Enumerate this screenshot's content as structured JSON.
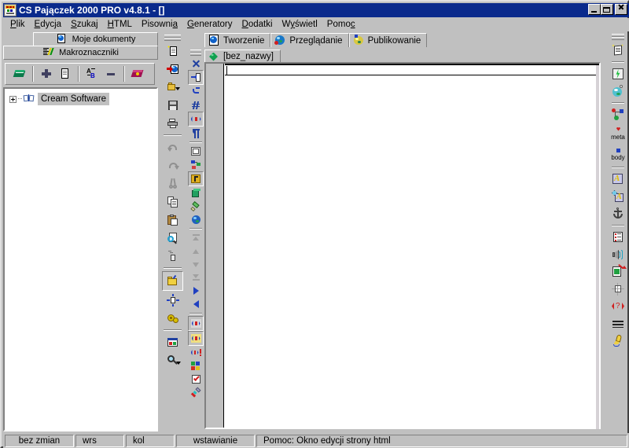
{
  "window": {
    "title": "CS Pajączek 2000 PRO v4.8.1 - []",
    "icon": "app-icon",
    "buttons": {
      "minimize": "_",
      "maximize": "□",
      "close": "✕"
    }
  },
  "menubar": {
    "items": [
      {
        "label": "Plik",
        "accel": "P"
      },
      {
        "label": "Edycja",
        "accel": "E"
      },
      {
        "label": "Szukaj",
        "accel": "S"
      },
      {
        "label": "HTML",
        "accel": "H"
      },
      {
        "label": "Pisownia",
        "accel": "a"
      },
      {
        "label": "Generatory",
        "accel": "G"
      },
      {
        "label": "Dodatki",
        "accel": "D"
      },
      {
        "label": "Wyświetl",
        "accel": "y"
      },
      {
        "label": "Pomoc",
        "accel": "c"
      }
    ]
  },
  "left_panel": {
    "tabs": [
      {
        "label": "Moje dokumenty",
        "icon": "globe-page-icon",
        "selected": true
      },
      {
        "label": "Makroznaczniki",
        "icon": "macro-lines-icon",
        "selected": false
      }
    ],
    "toolbar": [
      {
        "name": "open-book-button",
        "icon": "green-book-icon"
      },
      {
        "name": "add-button",
        "icon": "plus-icon"
      },
      {
        "name": "new-document-button",
        "icon": "document-icon"
      },
      {
        "name": "rename-button",
        "icon": "rename-ab-icon"
      },
      {
        "name": "remove-button",
        "icon": "minus-icon"
      },
      {
        "name": "close-book-button",
        "icon": "red-book-icon"
      }
    ],
    "tree": [
      {
        "label": "Cream Software",
        "icon": "open-book-icon",
        "expanded": false,
        "selected": true
      }
    ]
  },
  "main": {
    "tabs": [
      {
        "label": "Tworzenie",
        "icon": "globe-page-icon",
        "active": true
      },
      {
        "label": "Przeglądanie",
        "icon": "globe-blue-icon",
        "active": false
      },
      {
        "label": "Publikowanie",
        "icon": "globe-upload-icon",
        "active": false
      }
    ],
    "document_tabs": [
      {
        "label": "[bez_nazwy]",
        "icon": "green-diamond-icon",
        "active": true
      }
    ],
    "editor": {
      "content": "",
      "gutter_visible": true
    }
  },
  "toolbar_main": {
    "items": [
      {
        "name": "new-document",
        "icon": "new-doc-icon"
      },
      {
        "name": "new-web-document",
        "icon": "new-web-doc-icon"
      },
      {
        "name": "open-file",
        "icon": "open-folder-icon"
      },
      {
        "name": "save-file",
        "icon": "save-disk-icon"
      },
      {
        "name": "print",
        "icon": "printer-icon"
      },
      {
        "name": "undo",
        "icon": "undo-arrow-icon"
      },
      {
        "name": "redo",
        "icon": "redo-arrow-icon"
      },
      {
        "name": "cut",
        "icon": "scissors-icon"
      },
      {
        "name": "copy",
        "icon": "copy-icon"
      },
      {
        "name": "paste",
        "icon": "paste-icon"
      },
      {
        "name": "find",
        "icon": "magnifier-page-icon"
      },
      {
        "name": "replace",
        "icon": "replace-icon"
      },
      {
        "name": "project-folder",
        "icon": "yellow-folder-icon"
      },
      {
        "name": "insert-element",
        "icon": "insert-node-icon"
      },
      {
        "name": "settings",
        "icon": "gears-icon"
      },
      {
        "name": "preview-window",
        "icon": "preview-window-icon"
      },
      {
        "name": "zoom",
        "icon": "magnifier-icon"
      }
    ]
  },
  "toolbar_editor": {
    "items": [
      {
        "name": "close-document",
        "icon": "close-x-icon"
      },
      {
        "name": "insert-tag",
        "icon": "insert-tag-icon"
      },
      {
        "name": "goto-line",
        "icon": "goto-icon"
      },
      {
        "name": "special-char",
        "icon": "hash-icon"
      },
      {
        "name": "tag-marker",
        "icon": "tag-brackets-icon"
      },
      {
        "name": "paragraph-marks",
        "icon": "pilcrow-icon"
      },
      {
        "name": "frame-tool",
        "icon": "frame-icon"
      },
      {
        "name": "structure-tool",
        "icon": "structure-icon"
      },
      {
        "name": "highlight-tool",
        "icon": "highlight-icon"
      },
      {
        "name": "box-tool",
        "icon": "green-box-icon"
      },
      {
        "name": "eraser-tool",
        "icon": "eraser-icon"
      },
      {
        "name": "browser-tool",
        "icon": "globe-small-icon"
      },
      {
        "name": "goto-top",
        "icon": "top-arrow-icon"
      },
      {
        "name": "page-up",
        "icon": "up-arrow-icon"
      },
      {
        "name": "page-down",
        "icon": "down-arrow-icon"
      },
      {
        "name": "goto-bottom",
        "icon": "bottom-arrow-icon"
      },
      {
        "name": "next-tag",
        "icon": "right-triangle-icon"
      },
      {
        "name": "prev-tag",
        "icon": "left-triangle-icon"
      },
      {
        "name": "tag-blue",
        "icon": "tag-blue-icon"
      },
      {
        "name": "tag-yellow",
        "icon": "tag-yellow-icon"
      },
      {
        "name": "tag-alert",
        "icon": "tag-alert-icon"
      },
      {
        "name": "colors",
        "icon": "color-squares-icon"
      },
      {
        "name": "validate",
        "icon": "checkbox-icon"
      },
      {
        "name": "color-picker",
        "icon": "eyedropper-icon"
      }
    ]
  },
  "toolbar_right": {
    "items": [
      {
        "name": "new-html-page",
        "icon": "page-sparkle-icon",
        "label": ""
      },
      {
        "name": "quick-tags",
        "icon": "lightning-icon",
        "label": ""
      },
      {
        "name": "global-link",
        "icon": "globe-pin-icon",
        "label": ""
      },
      {
        "name": "site-map",
        "icon": "sitemap-icon",
        "label": ""
      },
      {
        "name": "meta-tags",
        "icon": "meta-icon",
        "label": "meta"
      },
      {
        "name": "body-tag",
        "icon": "body-icon",
        "label": "body"
      },
      {
        "name": "font-format",
        "icon": "font-a-icon",
        "label": ""
      },
      {
        "name": "font-style",
        "icon": "font-style-icon",
        "label": ""
      },
      {
        "name": "anchor",
        "icon": "anchor-icon",
        "label": ""
      },
      {
        "name": "list-tool",
        "icon": "list-icon",
        "label": ""
      },
      {
        "name": "sound",
        "icon": "speaker-icon",
        "label": ""
      },
      {
        "name": "image-insert",
        "icon": "image-arrow-icon",
        "label": ""
      },
      {
        "name": "table-insert",
        "icon": "table-icon",
        "label": ""
      },
      {
        "name": "comment",
        "icon": "question-tag-icon",
        "label": ""
      },
      {
        "name": "horizontal-rule",
        "icon": "hr-icon",
        "label": ""
      },
      {
        "name": "custom-edit",
        "icon": "pencil-icon",
        "label": ""
      }
    ]
  },
  "statusbar": {
    "modified": "bez zmian",
    "row": "wrs",
    "col": "kol",
    "mode": "wstawianie",
    "hint": "Pomoc: Okno edycji strony html"
  },
  "colors": {
    "face": "#c0c0c0",
    "title_active": "#0a2a8c",
    "title_text": "#ffffff",
    "editor_bg": "#ffffff",
    "shadow": "#808080",
    "highlight": "#ffffff"
  }
}
